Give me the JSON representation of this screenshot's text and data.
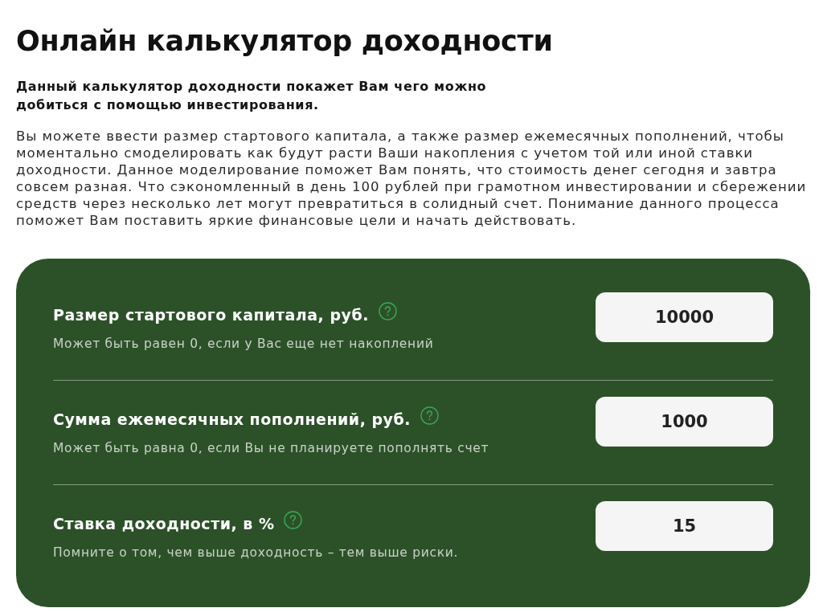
{
  "title": "Онлайн калькулятор доходности",
  "lead": "Данный калькулятор доходности покажет Вам чего можно добиться с помощью инвестирования.",
  "description": "Вы можете ввести размер стартового капитала, а также размер ежемесячных пополнений, чтобы моментально смоделировать как будут расти Ваши накопления с учетом той или иной ставки доходности. Данное моделирование поможет Вам понять, что стоимость денег сегодня и завтра совсем разная. Что сэкономленный в день 100 рублей при грамотном инвестировании и сбережении средств через несколько лет могут превратиться в солидный счет. Понимание данного процесса поможет Вам поставить яркие финансовые цели и начать действовать.",
  "calculator": {
    "fields": [
      {
        "label": "Размер стартового капитала, руб.",
        "hint": "Может быть равен 0, если у Вас еще нет накоплений",
        "value": "10000"
      },
      {
        "label": "Сумма ежемесячных пополнений, руб.",
        "hint": "Может быть равна 0, если Вы не планируете пополнять счет",
        "value": "1000"
      },
      {
        "label": "Ставка доходности, в %",
        "hint": "Помните о том, чем выше доходность – тем выше риски.",
        "value": "15"
      }
    ]
  }
}
